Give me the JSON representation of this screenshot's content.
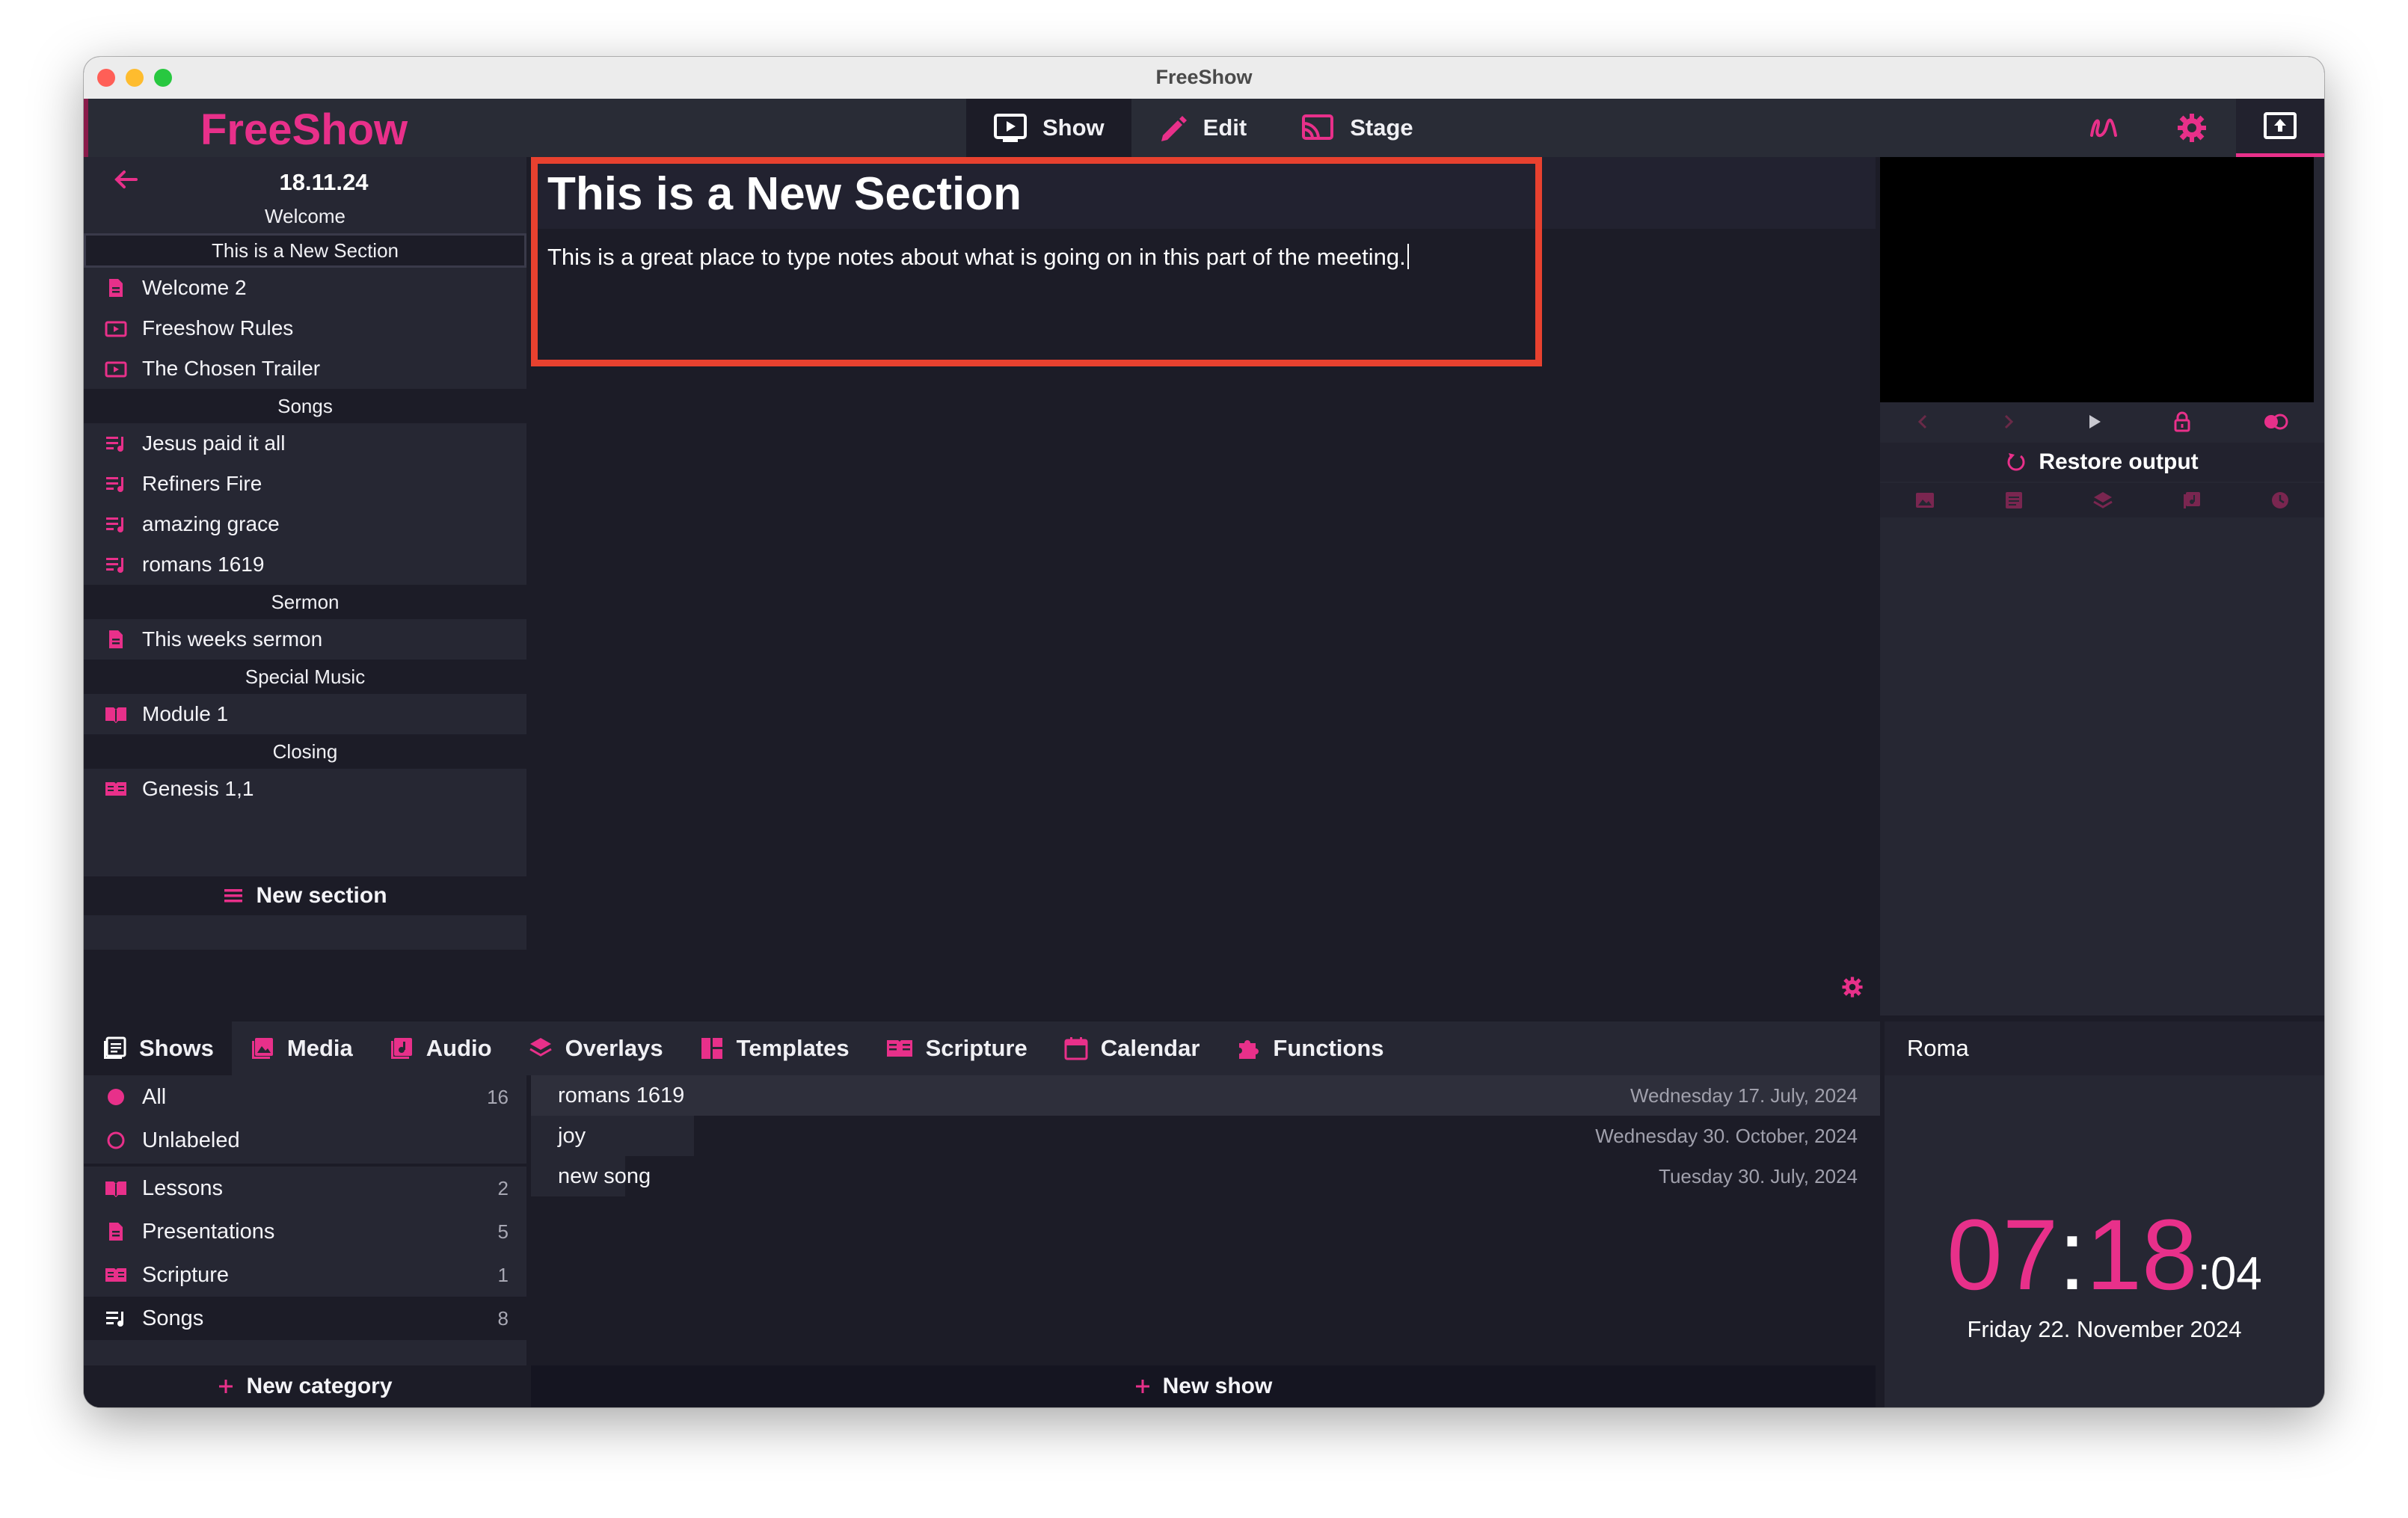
{
  "window": {
    "title": "FreeShow"
  },
  "app": {
    "logo": "FreeShow",
    "accent": "#e8308a"
  },
  "modes": [
    {
      "label": "Show",
      "icon": "play-screen-icon",
      "active": true
    },
    {
      "label": "Edit",
      "icon": "pencil-icon",
      "active": false
    },
    {
      "label": "Stage",
      "icon": "cast-icon",
      "active": false
    }
  ],
  "top_right_buttons": [
    "draw-icon",
    "settings-gear-icon",
    "output-screen-icon"
  ],
  "project": {
    "date": "18.11.24",
    "rows": [
      {
        "kind": "section",
        "label": "Welcome"
      },
      {
        "kind": "section",
        "label": "This is a New Section",
        "selected": true
      },
      {
        "kind": "item",
        "icon": "presentation-icon",
        "label": "Welcome 2"
      },
      {
        "kind": "item",
        "icon": "video-icon",
        "label": "Freeshow Rules"
      },
      {
        "kind": "item",
        "icon": "video-icon",
        "label": "The Chosen Trailer"
      },
      {
        "kind": "section",
        "label": "Songs"
      },
      {
        "kind": "item",
        "icon": "song-icon",
        "label": "Jesus paid it all"
      },
      {
        "kind": "item",
        "icon": "song-icon",
        "label": "Refiners Fire"
      },
      {
        "kind": "item",
        "icon": "song-icon",
        "label": "amazing grace"
      },
      {
        "kind": "item",
        "icon": "song-icon",
        "label": "romans 1619"
      },
      {
        "kind": "section",
        "label": "Sermon"
      },
      {
        "kind": "item",
        "icon": "presentation-icon",
        "label": "This weeks sermon"
      },
      {
        "kind": "section",
        "label": "Special Music"
      },
      {
        "kind": "item",
        "icon": "lesson-icon",
        "label": "Module 1"
      },
      {
        "kind": "section",
        "label": "Closing"
      },
      {
        "kind": "item",
        "icon": "scripture-icon",
        "label": "Genesis 1,1"
      }
    ],
    "new_section_label": "New section"
  },
  "editor": {
    "section_title": "This is a New Section",
    "notes": "This is a great place to type notes about what is going on in this part of the meeting."
  },
  "output": {
    "controls": [
      "prev-icon",
      "next-icon",
      "play-icon",
      "lock-icon",
      "transition-icon"
    ],
    "restore_label": "Restore output",
    "tabs": [
      "background-icon",
      "slide-icon",
      "overlay-layers-icon",
      "audio-icon",
      "timer-icon"
    ]
  },
  "drawer": {
    "tabs": [
      {
        "label": "Shows",
        "icon": "shows-icon",
        "active": true
      },
      {
        "label": "Media",
        "icon": "media-icon"
      },
      {
        "label": "Audio",
        "icon": "audio-icon"
      },
      {
        "label": "Overlays",
        "icon": "overlays-icon"
      },
      {
        "label": "Templates",
        "icon": "templates-icon"
      },
      {
        "label": "Scripture",
        "icon": "scripture-icon"
      },
      {
        "label": "Calendar",
        "icon": "calendar-icon"
      },
      {
        "label": "Functions",
        "icon": "functions-icon"
      }
    ],
    "categories": [
      {
        "label": "All",
        "count": "16",
        "icon": "filled-circle-icon"
      },
      {
        "label": "Unlabeled",
        "count": "",
        "icon": "empty-circle-icon"
      },
      {
        "label": "Lessons",
        "count": "2",
        "icon": "lesson-icon"
      },
      {
        "label": "Presentations",
        "count": "5",
        "icon": "presentation-icon"
      },
      {
        "label": "Scripture",
        "count": "1",
        "icon": "scripture-icon"
      },
      {
        "label": "Songs",
        "count": "8",
        "icon": "song-icon",
        "selected": true
      }
    ],
    "new_category_label": "New category",
    "shows": [
      {
        "name": "romans 1619",
        "date": "Wednesday 17. July, 2024"
      },
      {
        "name": "joy",
        "date": "Wednesday 30. October, 2024"
      },
      {
        "name": "new song",
        "date": "Tuesday 30. July, 2024"
      }
    ],
    "new_show_label": "New show"
  },
  "clock": {
    "city": "Roma",
    "hours": "07",
    "minutes": "18",
    "seconds": "04",
    "date": "Friday 22. November 2024"
  }
}
